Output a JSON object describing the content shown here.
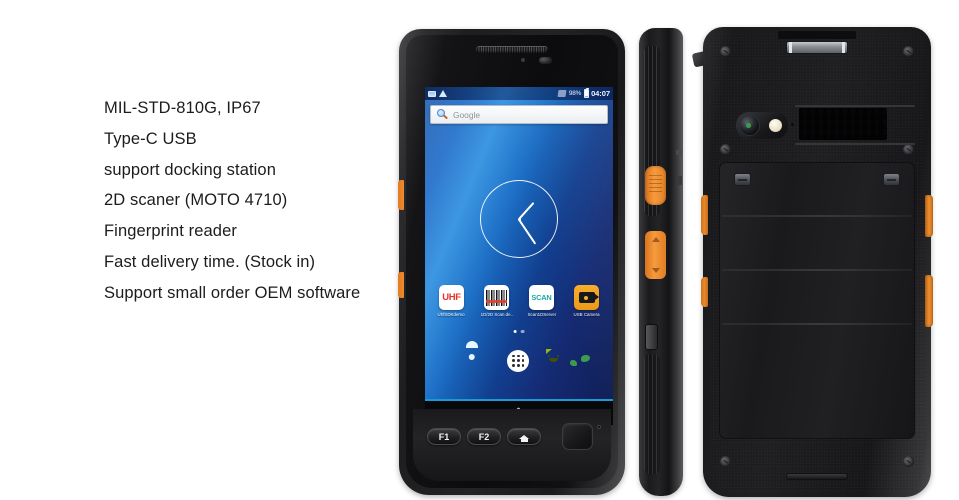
{
  "features": {
    "lines": [
      "MIL-STD-810G, IP67",
      "Type-C USB",
      "support docking station",
      "2D scaner (MOTO 4710)",
      "Fingerprint reader",
      "Fast delivery time. (Stock in)",
      "Support small order OEM software"
    ]
  },
  "device_front": {
    "label": "rugged-handheld-front-view",
    "screen": {
      "statusbar": {
        "sd_icon": "sd-card-icon",
        "wifi_icon": "wifi-icon",
        "mute_icon": "mute-icon",
        "battery_percent": "98%",
        "battery_icon": "battery-icon",
        "time": "04:07"
      },
      "search_widget": {
        "icon": "search-icon",
        "text": "Google"
      },
      "clock_widget": {
        "name": "analog-clock-widget",
        "hour_deg": 42,
        "minute_deg": 146
      },
      "apps": [
        {
          "name": "uhf-sdk-demo",
          "icon": "uhf-icon",
          "icon_text": "UHF",
          "label": "UhfSDKdemo"
        },
        {
          "name": "scan-demo",
          "icon": "barcode-icon",
          "icon_text": "",
          "label": "1D/2D Scan de.."
        },
        {
          "name": "scan-server",
          "icon": "scan-icon",
          "icon_text": "SCAN",
          "label": "Scan1DServer"
        },
        {
          "name": "usb-camera",
          "icon": "usb-camera-icon",
          "icon_text": "",
          "label": "USB Camera"
        }
      ],
      "page_dots": 2,
      "dock": [
        {
          "name": "phone",
          "icon": "phone-icon"
        },
        {
          "name": "contacts",
          "icon": "contacts-icon"
        },
        {
          "name": "app-drawer",
          "icon": "app-drawer-icon"
        },
        {
          "name": "messaging",
          "icon": "message-icon"
        },
        {
          "name": "browser",
          "icon": "browser-icon"
        }
      ],
      "navbar": [
        {
          "name": "recents",
          "icon": "recents-icon"
        },
        {
          "name": "home",
          "icon": "home-diamond-icon"
        },
        {
          "name": "back",
          "icon": "back-arrow-icon"
        }
      ]
    },
    "hardware_keys": [
      {
        "name": "f1-key",
        "label": "F1"
      },
      {
        "name": "f2-key",
        "label": "F2"
      },
      {
        "name": "home-key",
        "label": "",
        "icon": "home-icon"
      }
    ],
    "fingerprint_reader": "fingerprint-reader-pad"
  },
  "device_side": {
    "label": "rugged-handheld-side-view",
    "buttons": [
      {
        "name": "scan-trigger-button",
        "color": "#f79b3e"
      },
      {
        "name": "volume-rocker",
        "color": "#f79b3e"
      }
    ],
    "port": "type-c-usb-port"
  },
  "device_back": {
    "label": "rugged-handheld-back-view",
    "parts": [
      "barcode-scanner-window",
      "rear-camera",
      "camera-flash",
      "speaker-grille",
      "battery-cover",
      "battery-latch-left",
      "battery-latch-right",
      "bottom-speaker"
    ],
    "screw_count": 6
  },
  "colors": {
    "accent_orange": "#f79b3e",
    "body_dark": "#1c1c1e",
    "screen_blue": "#1667c8",
    "uhf_red": "#e8312a",
    "scan_teal": "#1aa6a0",
    "text": "#1c1c1c",
    "background": "#ffffff"
  }
}
